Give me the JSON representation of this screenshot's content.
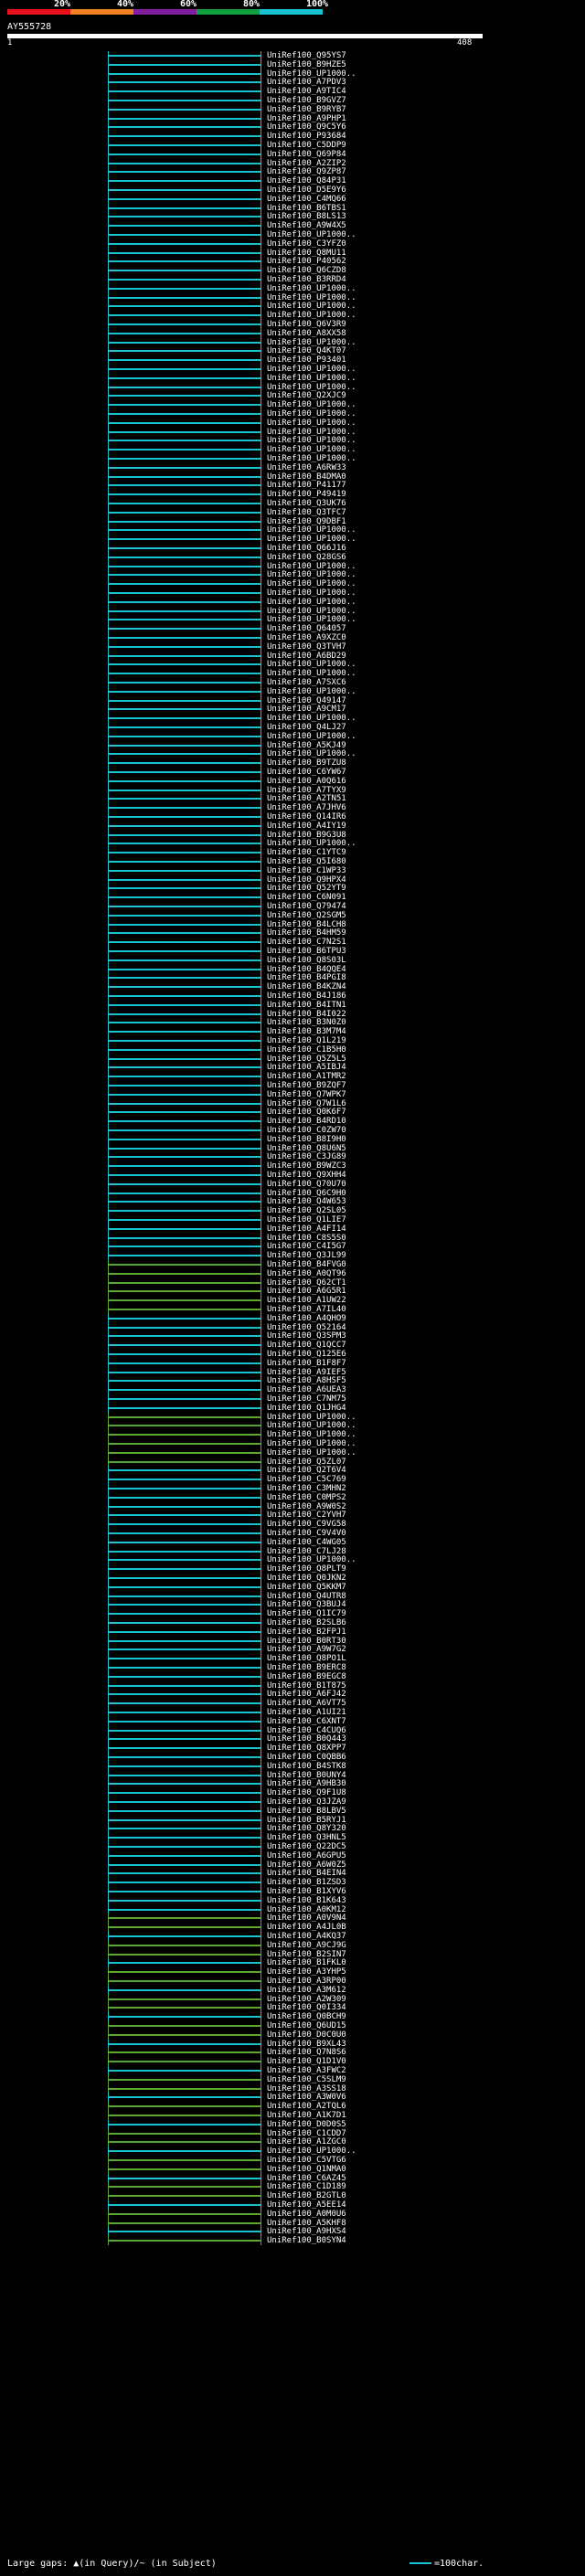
{
  "scale": {
    "labels": [
      "20%",
      "40%",
      "60%",
      "80%",
      "100%"
    ],
    "colors": [
      "#e8101c",
      "#f08020",
      "#8020a0",
      "#10a040",
      "#19c3d0"
    ]
  },
  "query": {
    "title": "AY555728",
    "start": "1",
    "end": "408"
  },
  "colors": {
    "cyan": "#19c3d0",
    "green": "#5aa830",
    "row_dark": "#0b0f22"
  },
  "hits": [
    "UniRef100_Q95YS7",
    "UniRef100_B9HZE5",
    "UniRef100_UP1000..",
    "UniRef100_A7PDV3",
    "UniRef100_A9TIC4",
    "UniRef100_B9GVZ7",
    "UniRef100_B9RYB7",
    "UniRef100_A9PHP1",
    "UniRef100_Q9C5Y6",
    "UniRef100_P93684",
    "UniRef100_C5DDP9",
    "UniRef100_Q69P84",
    "UniRef100_A2ZIP2",
    "UniRef100_Q9ZP87",
    "UniRef100_Q84P31",
    "UniRef100_D5E9Y6",
    "UniRef100_C4MQ66",
    "UniRef100_B6TBS1",
    "UniRef100_B8LS13",
    "UniRef100_A9W4X5",
    "UniRef100_UP1000..",
    "UniRef100_C3YFZ0",
    "UniRef100_Q8MU11",
    "UniRef100_P40562",
    "UniRef100_Q6CZD8",
    "UniRef100_B3RRD4",
    "UniRef100_UP1000..",
    "UniRef100_UP1000..",
    "UniRef100_UP1000..",
    "UniRef100_UP1000..",
    "UniRef100_Q6V3R9",
    "UniRef100_A8XX58",
    "UniRef100_UP1000..",
    "UniRef100_Q4KT07",
    "UniRef100_P93401",
    "UniRef100_UP1000..",
    "UniRef100_UP1000..",
    "UniRef100_UP1000..",
    "UniRef100_Q2XJC9",
    "UniRef100_UP1000..",
    "UniRef100_UP1000..",
    "UniRef100_UP1000..",
    "UniRef100_UP1000..",
    "UniRef100_UP1000..",
    "UniRef100_UP1000..",
    "UniRef100_UP1000..",
    "UniRef100_A6RW33",
    "UniRef100_B4DMA0",
    "UniRef100_P41177",
    "UniRef100_P49419",
    "UniRef100_Q3UK76",
    "UniRef100_Q3TFC7",
    "UniRef100_Q9DBF1",
    "UniRef100_UP1000..",
    "UniRef100_UP1000..",
    "UniRef100_Q66J16",
    "UniRef100_Q28GS6",
    "UniRef100_UP1000..",
    "UniRef100_UP1000..",
    "UniRef100_UP1000..",
    "UniRef100_UP1000..",
    "UniRef100_UP1000..",
    "UniRef100_UP1000..",
    "UniRef100_UP1000..",
    "UniRef100_Q64057",
    "UniRef100_A9XZC0",
    "UniRef100_Q3TVH7",
    "UniRef100_A6BD29",
    "UniRef100_UP1000..",
    "UniRef100_UP1000..",
    "UniRef100_A7SXC6",
    "UniRef100_UP1000..",
    "UniRef100_Q49147",
    "UniRef100_A9CM17",
    "UniRef100_UP1000..",
    "UniRef100_Q4LJ27",
    "UniRef100_UP1000..",
    "UniRef100_A5KJ49",
    "UniRef100_UP1000..",
    "UniRef100_B9TZU8",
    "UniRef100_C6YW67",
    "UniRef100_A0Q616",
    "UniRef100_A7TYX9",
    "UniRef100_A2TN51",
    "UniRef100_A7JHV6",
    "UniRef100_Q14IR6",
    "UniRef100_A4IY19",
    "UniRef100_B9G3U8",
    "UniRef100_UP1000..",
    "UniRef100_C1YTC9",
    "UniRef100_Q5I680",
    "UniRef100_C1WP33",
    "UniRef100_Q9HPX4",
    "UniRef100_Q52YT9",
    "UniRef100_C6N091",
    "UniRef100_Q79474",
    "UniRef100_Q2SGM5",
    "UniRef100_B4LCH8",
    "UniRef100_B4HM59",
    "UniRef100_C7N2S1",
    "UniRef100_B6TPU3",
    "UniRef100_Q8S03L",
    "UniRef100_B4QQE4",
    "UniRef100_B4PGI8",
    "UniRef100_B4KZN4",
    "UniRef100_B4J186",
    "UniRef100_B4ITN1",
    "UniRef100_B4I022",
    "UniRef100_B3N0Z0",
    "UniRef100_B3M7M4",
    "UniRef100_Q1L219",
    "UniRef100_C1B5H0",
    "UniRef100_Q5Z5L5",
    "UniRef100_A5IBJ4",
    "UniRef100_A1TMR2",
    "UniRef100_B9ZQF7",
    "UniRef100_Q7WPK7",
    "UniRef100_Q7W1L6",
    "UniRef100_Q0K6F7",
    "UniRef100_B4RD10",
    "UniRef100_C0ZW70",
    "UniRef100_B8I9H0",
    "UniRef100_Q8U6N5",
    "UniRef100_C3JG89",
    "UniRef100_B9WZC3",
    "UniRef100_Q9XHH4",
    "UniRef100_Q70U70",
    "UniRef100_Q6C9H0",
    "UniRef100_Q4W653",
    "UniRef100_Q2SL05",
    "UniRef100_Q1LIE7",
    "UniRef100_A4FI14",
    "UniRef100_C8S5S0",
    "UniRef100_C4I5G7",
    "UniRef100_Q3JL99",
    "UniRef100_B4FVG0",
    "UniRef100_A0QT96",
    "UniRef100_Q62CT1",
    "UniRef100_A6G5R1",
    "UniRef100_A1UW22",
    "UniRef100_A7IL40",
    "UniRef100_A4QHO9",
    "UniRef100_Q52164",
    "UniRef100_Q3SPM3",
    "UniRef100_Q1QCC7",
    "UniRef100_Q125E6",
    "UniRef100_B1F8F7",
    "UniRef100_A9IEF5",
    "UniRef100_A8HSF5",
    "UniRef100_A6UEA3",
    "UniRef100_C7NM75",
    "UniRef100_Q1JHG4",
    "UniRef100_UP1000..",
    "UniRef100_UP1000..",
    "UniRef100_UP1000..",
    "UniRef100_UP1000..",
    "UniRef100_UP1000..",
    "UniRef100_Q5ZL07",
    "UniRef100_Q2T6V4",
    "UniRef100_C5C769",
    "UniRef100_C3MHN2",
    "UniRef100_C0MPS2",
    "UniRef100_A9W0S2",
    "UniRef100_C2YVH7",
    "UniRef100_C9VG58",
    "UniRef100_C9V4V0",
    "UniRef100_C4WG05",
    "UniRef100_C7LJ28",
    "UniRef100_UP1000..",
    "UniRef100_Q8PLT9",
    "UniRef100_Q0JKN2",
    "UniRef100_Q5KKM7",
    "UniRef100_Q4UTR8",
    "UniRef100_Q3BUJ4",
    "UniRef100_Q1IC79",
    "UniRef100_B2SLB6",
    "UniRef100_B2FPJ1",
    "UniRef100_B0RT30",
    "UniRef100_A9W7G2",
    "UniRef100_Q8PO1L",
    "UniRef100_B9ERC8",
    "UniRef100_B9EGC8",
    "UniRef100_B1T875",
    "UniRef100_A6FJ42",
    "UniRef100_A6VT75",
    "UniRef100_A1UI21",
    "UniRef100_C6XNT7",
    "UniRef100_C4CUQ6",
    "UniRef100_B0Q443",
    "UniRef100_Q8XPP7",
    "UniRef100_C0QBB6",
    "UniRef100_B4STK8",
    "UniRef100_B0UNY4",
    "UniRef100_A9HB30",
    "UniRef100_Q9F1U8",
    "UniRef100_Q3JZA9",
    "UniRef100_B8LBV5",
    "UniRef100_B5RYJ1",
    "UniRef100_Q8Y320",
    "UniRef100_Q3HNL5",
    "UniRef100_Q22DC5",
    "UniRef100_A6GPU5",
    "UniRef100_A6W0Z5",
    "UniRef100_B4EIN4",
    "UniRef100_B1ZSD3",
    "UniRef100_B1XYV6",
    "UniRef100_B1K643",
    "UniRef100_A0KM12",
    "UniRef100_A0V9N4",
    "UniRef100_A4JL0B",
    "UniRef100_A4KQ37",
    "UniRef100_A9CJ9G",
    "UniRef100_B2SIN7",
    "UniRef100_B1FKL0",
    "UniRef100_A3YHP5",
    "UniRef100_A3RP00",
    "UniRef100_A3M612",
    "UniRef100_A2W309",
    "UniRef100_Q0I334",
    "UniRef100_Q0BCH9",
    "UniRef100_Q6UD15",
    "UniRef100_D0C0U0",
    "UniRef100_B9XL43",
    "UniRef100_Q7N8S6",
    "UniRef100_Q1D1V0",
    "UniRef100_A3FWC2",
    "UniRef100_C5SLM9",
    "UniRef100_A3SS18",
    "UniRef100_A3W0V6",
    "UniRef100_A2TQL6",
    "UniRef100_A1K7D1",
    "UniRef100_D0D0S5",
    "UniRef100_C1CDD7",
    "UniRef100_A1ZGC0",
    "UniRef100_UP1000..",
    "UniRef100_C5VTG6",
    "UniRef100_Q1NMA0",
    "UniRef100_C6AZ45",
    "UniRef100_C1D189",
    "UniRef100_B2GTL0",
    "UniRef100_A5EE14",
    "UniRef100_A0M0U6",
    "UniRef100_A5KHF8",
    "UniRef100_A9HXS4",
    "UniRef100_B0SYN4"
  ],
  "footer": {
    "gaps_label": "Large gaps: ▲(in Query)/~ (in Subject)",
    "scale_label": "=100char."
  }
}
